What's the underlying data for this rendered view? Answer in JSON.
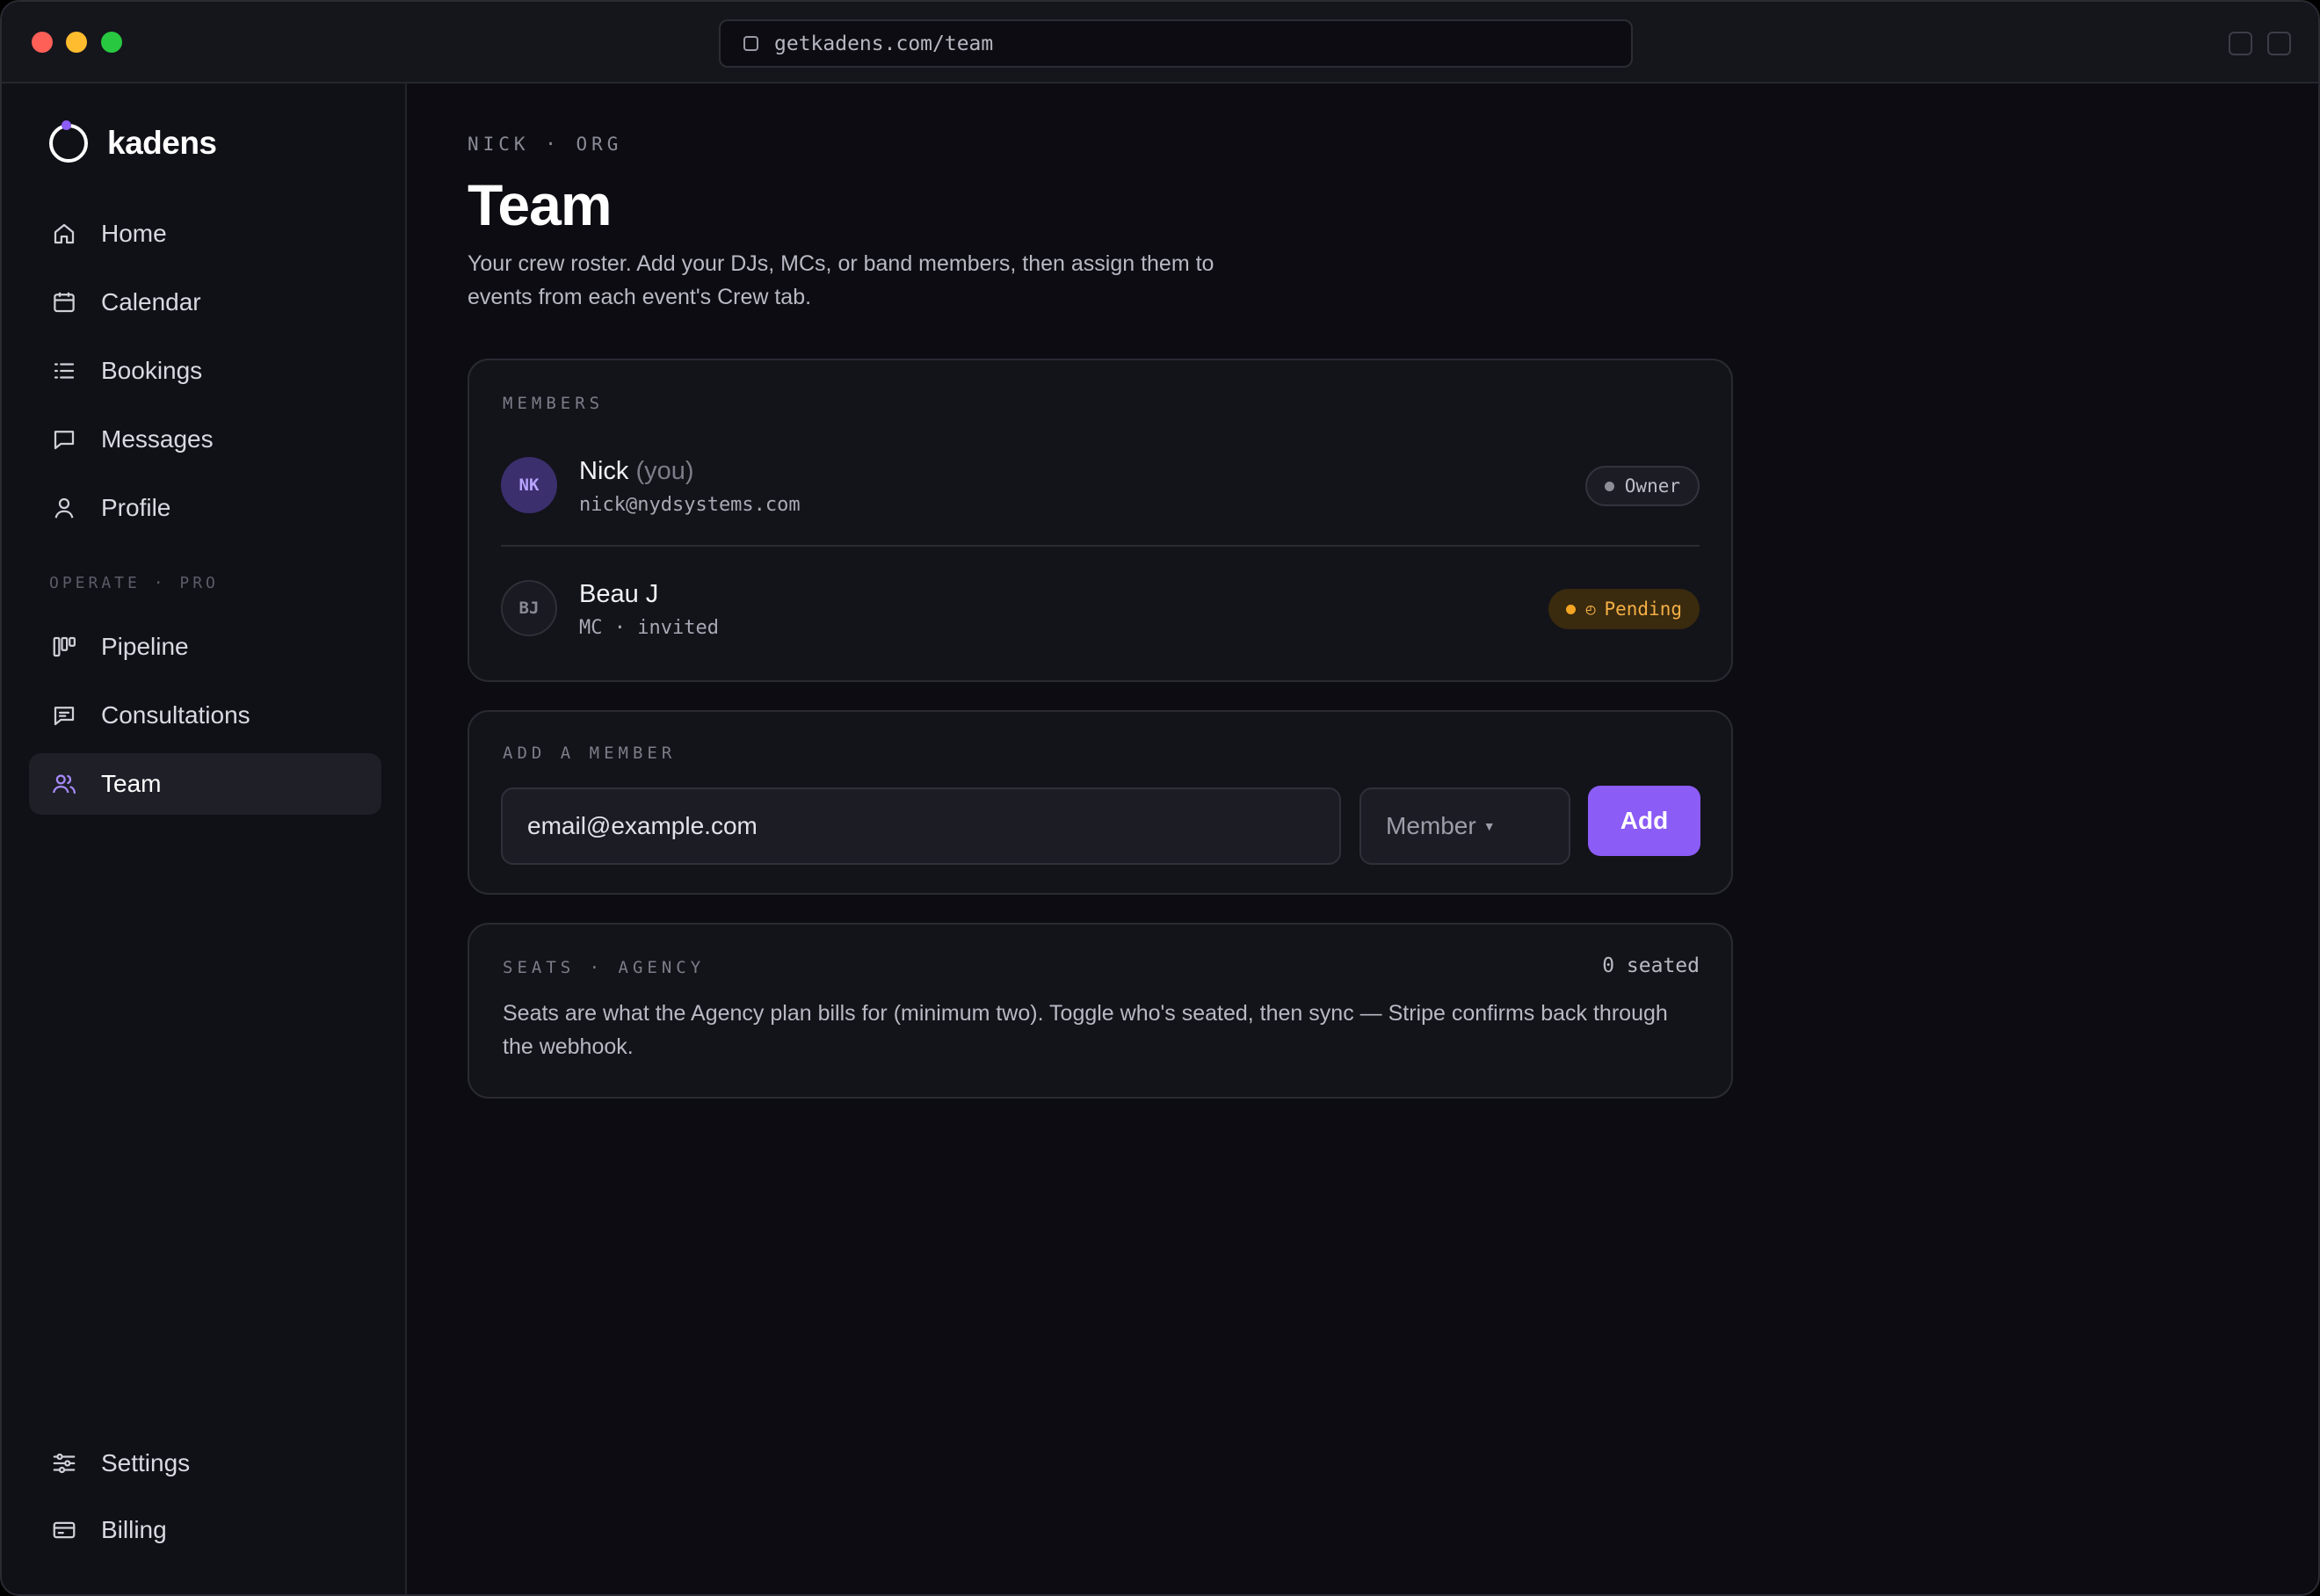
{
  "browser": {
    "url": "getkadens.com/team"
  },
  "sidebar": {
    "brand": "kadens",
    "items": [
      {
        "label": "Home",
        "icon": "home-icon"
      },
      {
        "label": "Calendar",
        "icon": "calendar-icon"
      },
      {
        "label": "Bookings",
        "icon": "list-icon"
      },
      {
        "label": "Messages",
        "icon": "message-icon"
      },
      {
        "label": "Profile",
        "icon": "user-icon"
      }
    ],
    "section_label": "OPERATE · PRO",
    "pro_items": [
      {
        "label": "Pipeline",
        "icon": "kanban-icon"
      },
      {
        "label": "Consultations",
        "icon": "chat-icon"
      },
      {
        "label": "Team",
        "icon": "users-icon",
        "active": true
      }
    ],
    "footer_items": [
      {
        "label": "Settings",
        "icon": "sliders-icon"
      },
      {
        "label": "Billing",
        "icon": "credit-card-icon"
      }
    ]
  },
  "header": {
    "breadcrumb": "NICK · ORG",
    "title": "Team",
    "description": "Your crew roster. Add your DJs, MCs, or band members, then assign them to events from each event's Crew tab."
  },
  "members": {
    "label": "MEMBERS",
    "rows": [
      {
        "initials": "NK",
        "name": "Nick",
        "suffix": "(you)",
        "sub": "nick@nydsystems.com",
        "badge": "Owner",
        "badge_status": "owner"
      },
      {
        "initials": "BJ",
        "name": "Beau J",
        "suffix": "",
        "sub": "MC · invited",
        "badge": "Pending",
        "badge_status": "pending"
      }
    ]
  },
  "add_member": {
    "label": "ADD A MEMBER",
    "email_placeholder": "email@example.com",
    "role_value": "Member",
    "button_label": "Add"
  },
  "seats": {
    "label": "SEATS · AGENCY",
    "count_text": "0 seated",
    "description": "Seats are what the Agency plan bills for (minimum two). Toggle who's seated, then sync — Stripe confirms back through the webhook."
  },
  "colors": {
    "accent": "#8b5cf6",
    "background": "#0c0c12",
    "pending": "#f5a524"
  }
}
